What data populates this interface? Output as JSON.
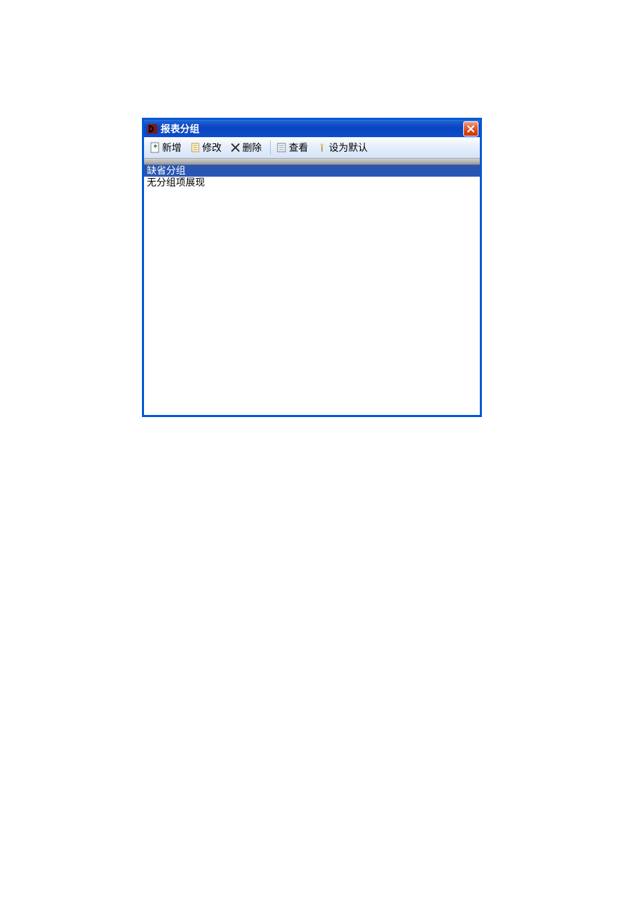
{
  "window": {
    "title": "报表分组"
  },
  "toolbar": {
    "add_label": "新增",
    "edit_label": "修改",
    "delete_label": "删除",
    "view_label": "查看",
    "default_label": "设为默认"
  },
  "list": {
    "items": [
      {
        "label": "缺省分组",
        "selected": true
      },
      {
        "label": "无分组项展现",
        "selected": false
      }
    ]
  },
  "colors": {
    "titlebar_blue": "#0a46c2",
    "border_blue": "#0058d4",
    "close_red": "#d64515",
    "selection_blue": "#2956b2"
  }
}
